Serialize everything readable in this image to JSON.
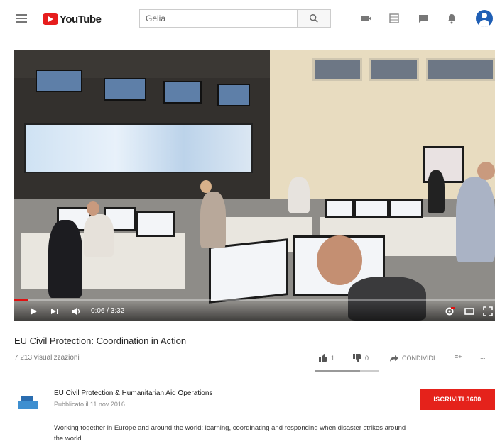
{
  "header": {
    "logo_text": "YouTube",
    "search_value": "Gelia",
    "icons": [
      "menu-icon",
      "search-icon",
      "create-video-icon",
      "apps-grid-icon",
      "messages-icon",
      "notifications-bell-icon",
      "account-avatar-icon"
    ]
  },
  "player": {
    "time": "0:06 / 3:32",
    "progress_fraction": 0.03,
    "controls": [
      "play-icon",
      "next-icon",
      "volume-icon",
      "settings-icon",
      "theater-mode-icon",
      "fullscreen-icon"
    ]
  },
  "video": {
    "title": "EU Civil Protection: Coordination in Action",
    "views": "7 213 visualizzazioni"
  },
  "actions": {
    "like_count": "1",
    "dislike_count": "0",
    "share_label": "CONDIVIDI",
    "save_label": "≡+",
    "more_label": "..."
  },
  "channel": {
    "name": "EU Civil Protection & Humanitarian Aid Operations",
    "published": "Pubblicato il 11 nov 2016",
    "subscribe_label": "ISCRIVITI 3600"
  },
  "description": "Working together in Europe and around the world: learning, coordinating and responding when disaster strikes around the world.",
  "colors": {
    "brand_red": "#e61d1d",
    "subscribe_red": "#e5221b",
    "progress_red": "#e01010"
  }
}
